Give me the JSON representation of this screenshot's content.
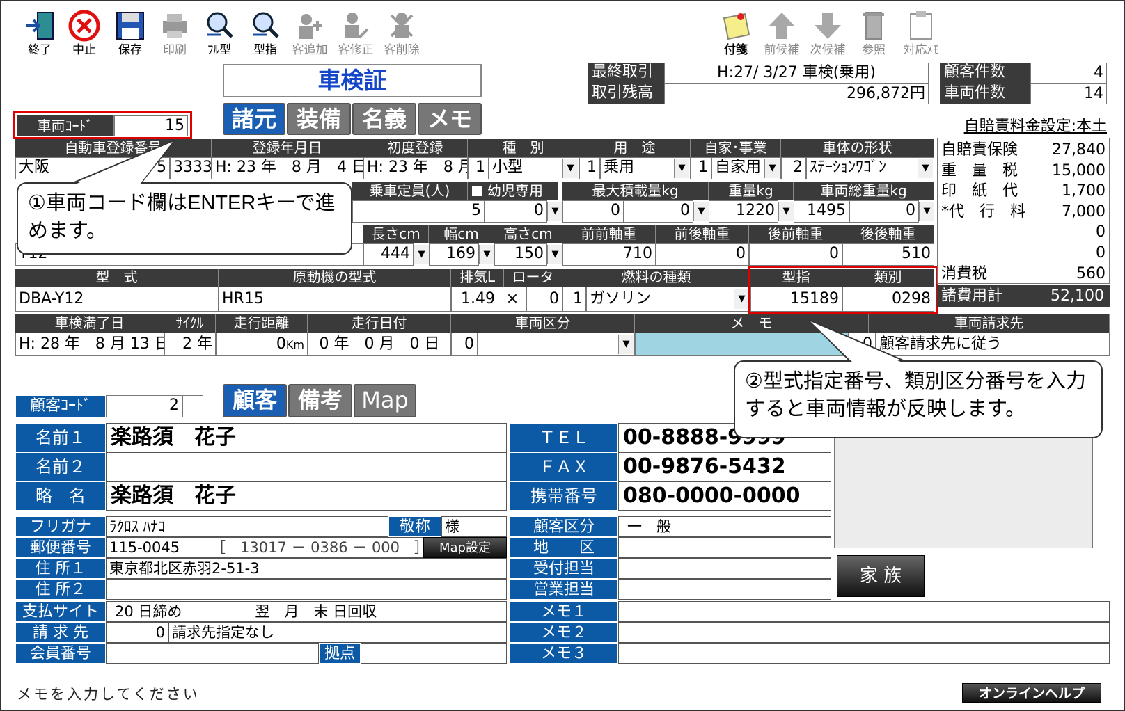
{
  "toolbar": {
    "left": [
      {
        "label": "終了",
        "icon": "exit-door-icon",
        "disabled": false
      },
      {
        "label": "中止",
        "icon": "cancel-x-icon",
        "disabled": false
      },
      {
        "label": "保存",
        "icon": "floppy-save-icon",
        "disabled": false
      },
      {
        "label": "印刷",
        "icon": "printer-icon",
        "disabled": true
      },
      {
        "label": "ﾌﾙ型",
        "icon": "search-magnifier-icon",
        "disabled": false
      },
      {
        "label": "型指",
        "icon": "search-magnifier-icon",
        "disabled": false
      },
      {
        "label": "客追加",
        "icon": "add-person-icon",
        "disabled": true
      },
      {
        "label": "客修正",
        "icon": "edit-person-icon",
        "disabled": true
      },
      {
        "label": "客削除",
        "icon": "delete-person-icon",
        "disabled": true
      }
    ],
    "right": [
      {
        "label": "付箋",
        "icon": "sticky-note-icon",
        "disabled": false
      },
      {
        "label": "前候補",
        "icon": "arrow-up-icon",
        "disabled": true
      },
      {
        "label": "次候補",
        "icon": "arrow-down-icon",
        "disabled": true
      },
      {
        "label": "参照",
        "icon": "book-reference-icon",
        "disabled": true
      },
      {
        "label": "対応ﾒﾓ",
        "icon": "clipboard-icon",
        "disabled": true
      }
    ]
  },
  "header": {
    "title": "車検証",
    "last_trade_label": "最終取引",
    "last_trade_value": "H:27/ 3/27 車検(乗用)",
    "balance_label": "取引残高",
    "balance_value": "296,872円",
    "customer_count_label": "顧客件数",
    "customer_count": "4",
    "vehicle_count_label": "車両件数",
    "vehicle_count": "14"
  },
  "vehicle_tabs": [
    "諸元",
    "装備",
    "名義",
    "メモ"
  ],
  "vehicle_code": {
    "label": "車両ｺｰﾄﾞ",
    "value": "15"
  },
  "row1": {
    "headers": [
      "自動車登録番号",
      "登録年月日",
      "初度登録",
      "種　別",
      "用　途",
      "自家･事業",
      "車体の形状"
    ],
    "reg_area": "大阪",
    "reg_class": "5",
    "reg_number": "3333",
    "reg_date": "H: 23 年　8 月　4 日",
    "first_reg": "H: 23 年　8 月",
    "kind_code": "1",
    "kind": "小型",
    "use_code": "1",
    "use": "乗用",
    "private_code": "1",
    "private": "自家用",
    "body_code": "2",
    "body": "ｽﾃｰｼｮﾝﾜｺﾞﾝ"
  },
  "row2": {
    "headers": [
      "乗車定員(人)",
      "幼児専用",
      "最大積載量kg",
      "重量kg",
      "車両総重量kg"
    ],
    "capacity": "5",
    "capacity_sub": "0",
    "max_load": "0",
    "max_load_sub": "0",
    "weight": "1220",
    "gross_weight": "1495",
    "gross_sub": "0"
  },
  "row3": {
    "headers": [
      "長さcm",
      "幅cm",
      "高さcm",
      "前前軸重",
      "前後軸重",
      "後前軸重",
      "後後軸重"
    ],
    "model_code": "Y12",
    "length": "444",
    "width": "169",
    "height": "150",
    "ff_axle": "710",
    "fr_axle": "0",
    "rf_axle": "0",
    "rr_axle": "510"
  },
  "row4": {
    "headers": [
      "型　式",
      "原動機の型式",
      "排気L",
      "ロータ",
      "燃料の種類",
      "型指",
      "類別"
    ],
    "model": "DBA-Y12",
    "engine": "HR15",
    "displacement": "1.49",
    "times": "×",
    "rotor": "0",
    "fuel_code": "1",
    "fuel": "ガソリン",
    "type_designation": "15189",
    "category": "0298"
  },
  "row5": {
    "headers": [
      "車検満了日",
      "ｻｲｸﾙ",
      "走行距離",
      "走行日付",
      "車両区分",
      "メ　モ",
      "車両請求先"
    ],
    "expiry": "H: 28 年　8 月 13 日",
    "cycle": "2 年",
    "mileage": "0",
    "mileage_unit": "Km",
    "run_date": "0 年　0 月　0 日",
    "vehicle_class_code": "0",
    "billing_code": "0",
    "billing": "顧客請求先に従う"
  },
  "jibaiseki": {
    "title": "自賠責料金設定:本土",
    "items": [
      {
        "label": "自賠責保険",
        "value": "27,840"
      },
      {
        "label": "重　量　税",
        "value": "15,000"
      },
      {
        "label": "印　紙　代",
        "value": "1,700"
      },
      {
        "label": "*代　行　料",
        "value": "7,000"
      },
      {
        "label": "",
        "value": "0"
      },
      {
        "label": "",
        "value": "0"
      },
      {
        "label": "消費税",
        "value": "560"
      }
    ],
    "total_label": "諸費用計",
    "total_value": "52,100"
  },
  "customer_code": {
    "label": "顧客ｺｰﾄﾞ",
    "value": "2"
  },
  "customer_tabs": [
    "顧客",
    "備考",
    "Map"
  ],
  "customer": {
    "name1_label": "名前１",
    "name1": "楽路須　花子",
    "name2_label": "名前２",
    "name2": "",
    "short_label": "略　名",
    "short": "楽路須　花子",
    "tel_label": "ＴＥＬ",
    "tel": "00-8888-9999",
    "fax_label": "ＦＡＸ",
    "fax": "00-9876-5432",
    "mobile_label": "携帯番号",
    "mobile": "080-0000-0000",
    "kana_label": "フリガナ",
    "kana": "ﾗｸﾛｽ ﾊﾅｺ",
    "honorific_label": "敬称",
    "honorific": "様",
    "zip_label": "郵便番号",
    "zip": "115-0045",
    "jis_code": "［　13017 － 0386 － 000　］",
    "map_button": "Map設定",
    "addr1_label": "住 所１",
    "addr1": "東京都北区赤羽2-51-3",
    "addr2_label": "住 所２",
    "addr2": "",
    "pay_label": "支払サイト",
    "pay": "20 日締め　　　　　翌　月　末 日回収",
    "bill_label": "請 求 先",
    "bill_code": "0",
    "bill": "請求先指定なし",
    "member_label": "会員番号",
    "member": "",
    "base_label": "拠点",
    "class_label": "顧客区分",
    "class": "一　般",
    "area_label": "地　　区",
    "area": "",
    "recv_label": "受付担当",
    "recv": "",
    "sales_label": "営業担当",
    "sales": "",
    "memo1_label": "メモ１",
    "memo2_label": "メモ２",
    "memo3_label": "メモ３",
    "family_button": "家 族"
  },
  "status": {
    "message": "メモを入力してください",
    "help_button": "オンラインヘルプ"
  },
  "callouts": {
    "one": "①車両コード欄はENTERキーで進めます。",
    "two": "②型式指定番号、類別区分番号を入力すると車両情報が反映します。"
  }
}
